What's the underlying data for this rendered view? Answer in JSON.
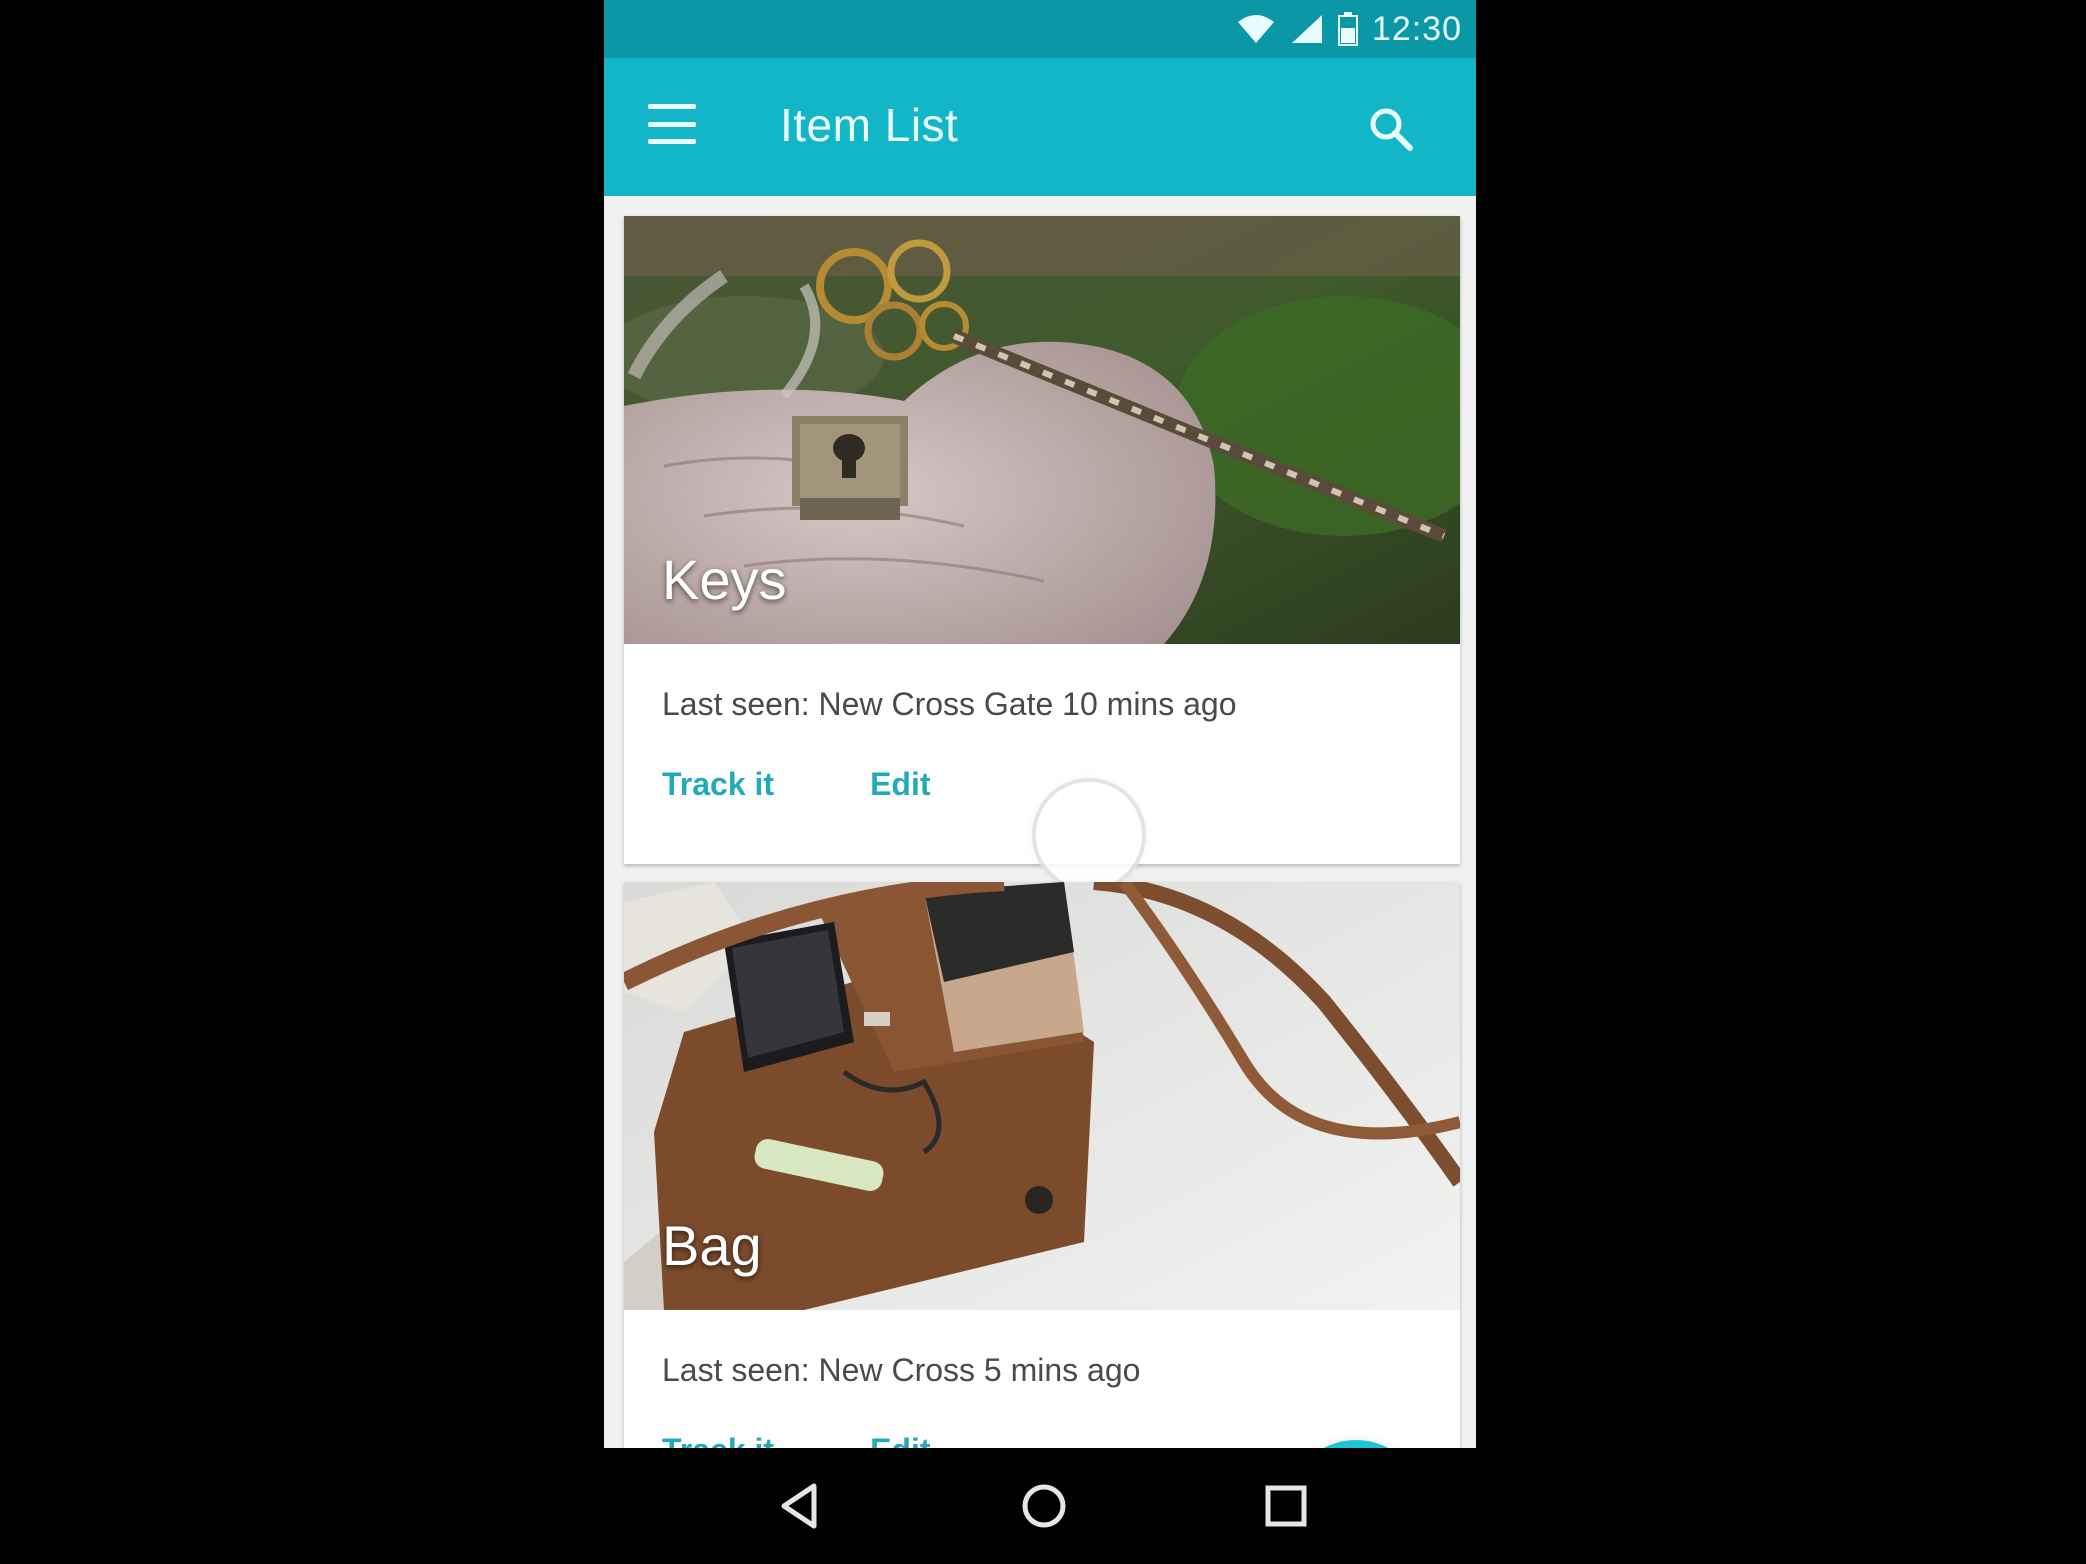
{
  "status_bar": {
    "time": "12:30",
    "icons": [
      "wifi-icon",
      "cell-signal-icon",
      "battery-icon"
    ],
    "color": "#0c97a6"
  },
  "app_bar": {
    "title": "Item List",
    "menu_icon": "hamburger-menu-icon",
    "search_icon": "search-icon",
    "color": "#13b6c6"
  },
  "cards": [
    {
      "title": "Keys",
      "subtitle": "Last seen: New Cross Gate 10 mins ago",
      "actions": [
        "Track it",
        "Edit"
      ]
    },
    {
      "title": "Bag",
      "subtitle": "Last seen: New Cross 5 mins ago",
      "actions": [
        "Track it",
        "Edit"
      ]
    }
  ],
  "fab": {
    "icon": "plus-icon",
    "label": "+",
    "color": "#1cc4d6"
  },
  "nav_bar": {
    "buttons": [
      "back-icon",
      "home-icon",
      "recents-icon"
    ]
  },
  "accent_color": "#23aab8"
}
